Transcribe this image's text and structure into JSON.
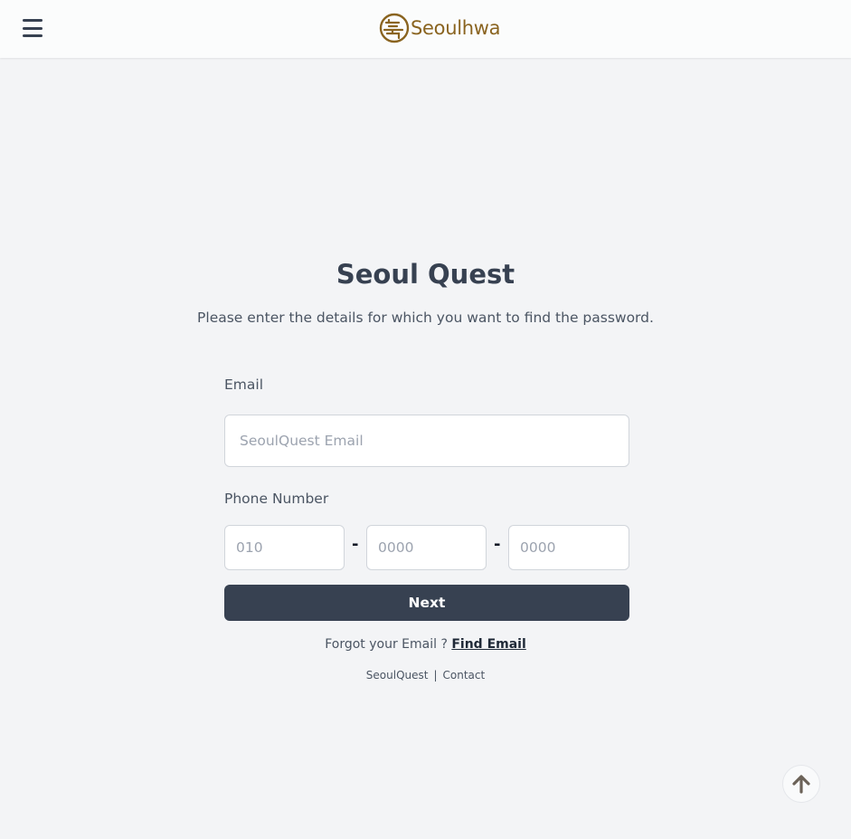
{
  "header": {
    "brand": "Seoulhwa",
    "brand_color": "#8a6420"
  },
  "icons": {
    "menu": "menu-icon",
    "logo": "seoulhwa-logo-icon",
    "scroll_top": "arrow-up-icon"
  },
  "main": {
    "title": "Seoul Quest",
    "subtitle": "Please enter the details for which you want to find the password.",
    "email_label": "Email",
    "email_placeholder": "SeoulQuest Email",
    "phone_label": "Phone Number",
    "phone_part1_placeholder": "010",
    "phone_part2_placeholder": "0000",
    "phone_part3_placeholder": "0000",
    "phone_separator": "-",
    "next_label": "Next",
    "forgot_text": "Forgot your Email ? ",
    "find_email_link": "Find Email"
  },
  "footer": {
    "link1": "SeoulQuest",
    "separator": "|",
    "link2": "Contact"
  },
  "colors": {
    "background": "#f3f4f6",
    "primary_button": "#374151"
  }
}
